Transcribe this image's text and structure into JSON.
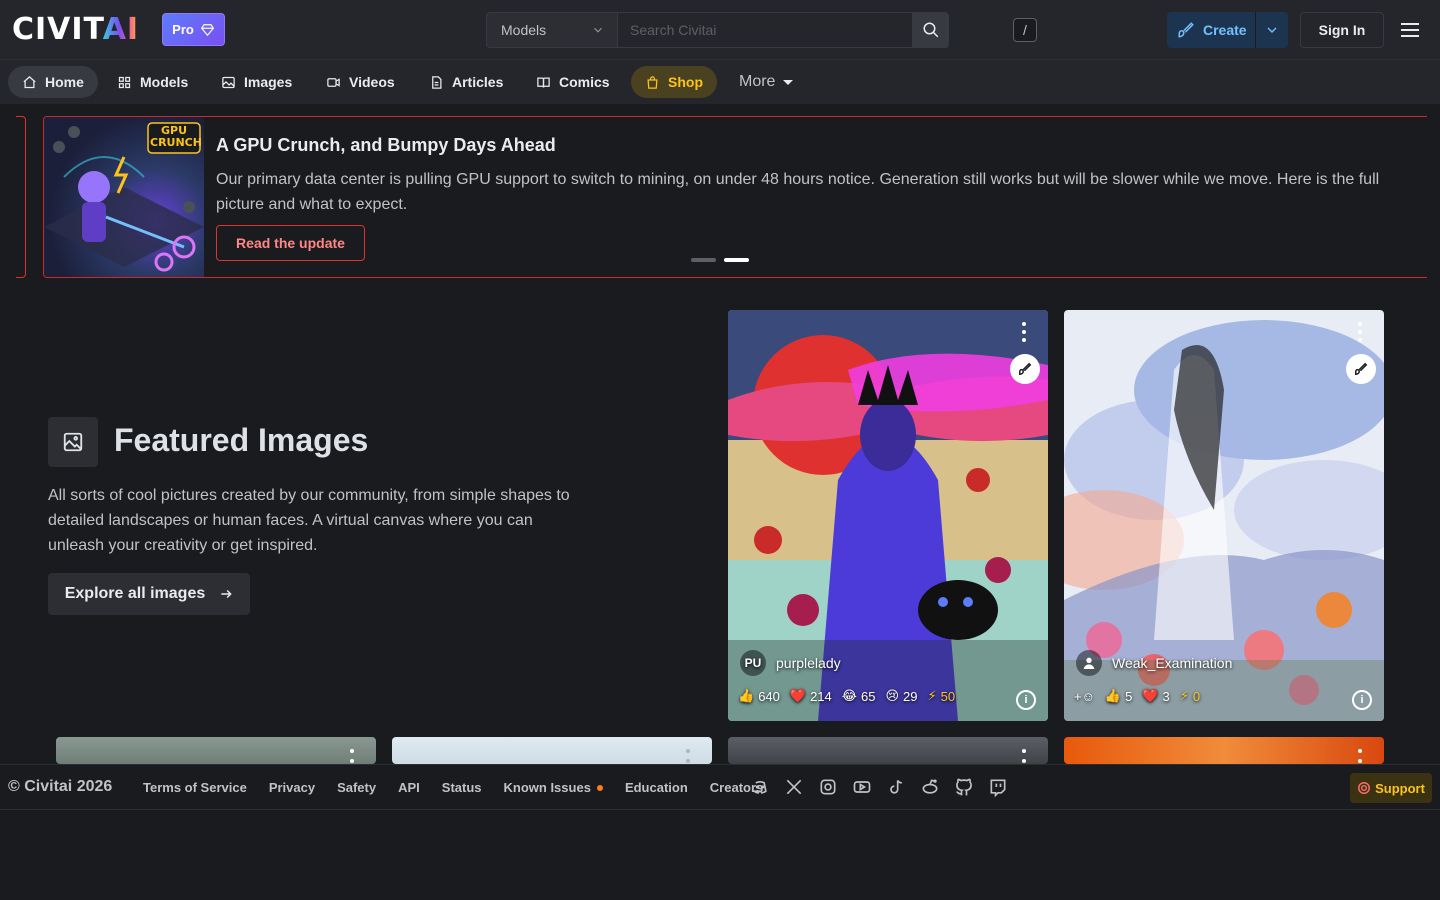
{
  "header": {
    "logo_main": "CIVIT",
    "logo_accent": "AI",
    "pro_label": "Pro",
    "search": {
      "category": "Models",
      "placeholder": "Search Civitai",
      "shortcut": "/"
    },
    "create_label": "Create",
    "signin_label": "Sign In"
  },
  "nav": {
    "items": [
      {
        "label": "Home",
        "icon": "home-icon"
      },
      {
        "label": "Models",
        "icon": "grid-icon"
      },
      {
        "label": "Images",
        "icon": "photo-icon"
      },
      {
        "label": "Videos",
        "icon": "video-icon"
      },
      {
        "label": "Articles",
        "icon": "file-icon"
      },
      {
        "label": "Comics",
        "icon": "book-icon"
      },
      {
        "label": "Shop",
        "icon": "bag-icon"
      }
    ],
    "more_label": "More"
  },
  "banner": {
    "image_text": "GPU CRUNCH",
    "title": "A GPU Crunch, and Bumpy Days Ahead",
    "text": "Our primary data center is pulling GPU support to switch to mining, on under 48 hours notice. Generation still works but will be slower while we move. Here is the full picture and what to expect.",
    "button_label": "Read the update",
    "slides_total": 2,
    "active_slide": 2
  },
  "featured": {
    "title": "Featured Images",
    "description": "All sorts of cool pictures created by our community, from simple shapes to detailed landscapes or human faces. A virtual canvas where you can unleash your creativity or get inspired.",
    "button_label": "Explore all images"
  },
  "cards": [
    {
      "avatar": "PU",
      "user": "purplelady",
      "likes": "640",
      "hearts": "214",
      "laughs": "65",
      "cries": "29",
      "buzz": "50"
    },
    {
      "avatar": "",
      "user": "Weak_Examination",
      "likes": "5",
      "hearts": "3",
      "buzz": "0"
    }
  ],
  "footer": {
    "copyright": "© Civitai 2026",
    "links": [
      "Terms of Service",
      "Privacy",
      "Safety",
      "API",
      "Status"
    ],
    "known_issues": "Known Issues",
    "links_after": [
      "Education",
      "Creators"
    ],
    "socials": [
      "discord-icon",
      "x-icon",
      "instagram-icon",
      "youtube-icon",
      "tiktok-icon",
      "reddit-icon",
      "github-icon",
      "twitch-icon"
    ],
    "support_label": "Support"
  },
  "colors": {
    "accent_blue": "#74c0fc",
    "shop_yellow": "#fcc419",
    "banner_red": "#e03131",
    "pro_violet": "#7950f2"
  }
}
